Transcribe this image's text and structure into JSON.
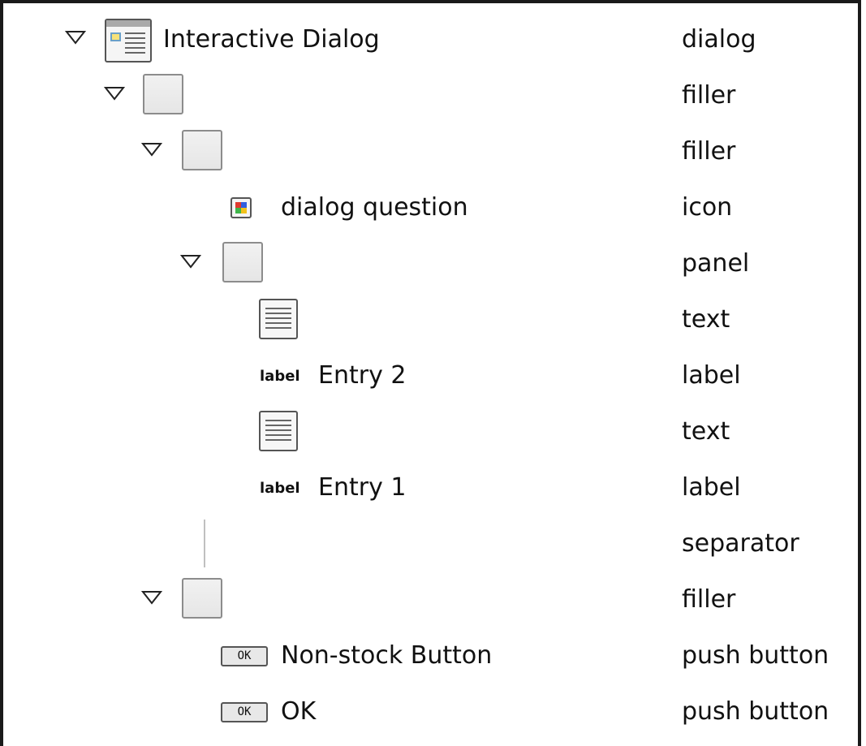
{
  "tree": {
    "rows": [
      {
        "name": "Interactive Dialog",
        "role": "dialog"
      },
      {
        "name": "",
        "role": "filler"
      },
      {
        "name": "",
        "role": "filler"
      },
      {
        "name": "dialog question",
        "role": "icon"
      },
      {
        "name": "",
        "role": "panel"
      },
      {
        "name": "",
        "role": "text"
      },
      {
        "name": "Entry 2",
        "role": "label"
      },
      {
        "name": "",
        "role": "text"
      },
      {
        "name": "Entry 1",
        "role": "label"
      },
      {
        "name": "",
        "role": "separator"
      },
      {
        "name": "",
        "role": "filler"
      },
      {
        "name": "Non-stock Button",
        "role": "push button"
      },
      {
        "name": "OK",
        "role": "push button"
      }
    ],
    "label_badge": "label",
    "ok_badge": "OK"
  }
}
